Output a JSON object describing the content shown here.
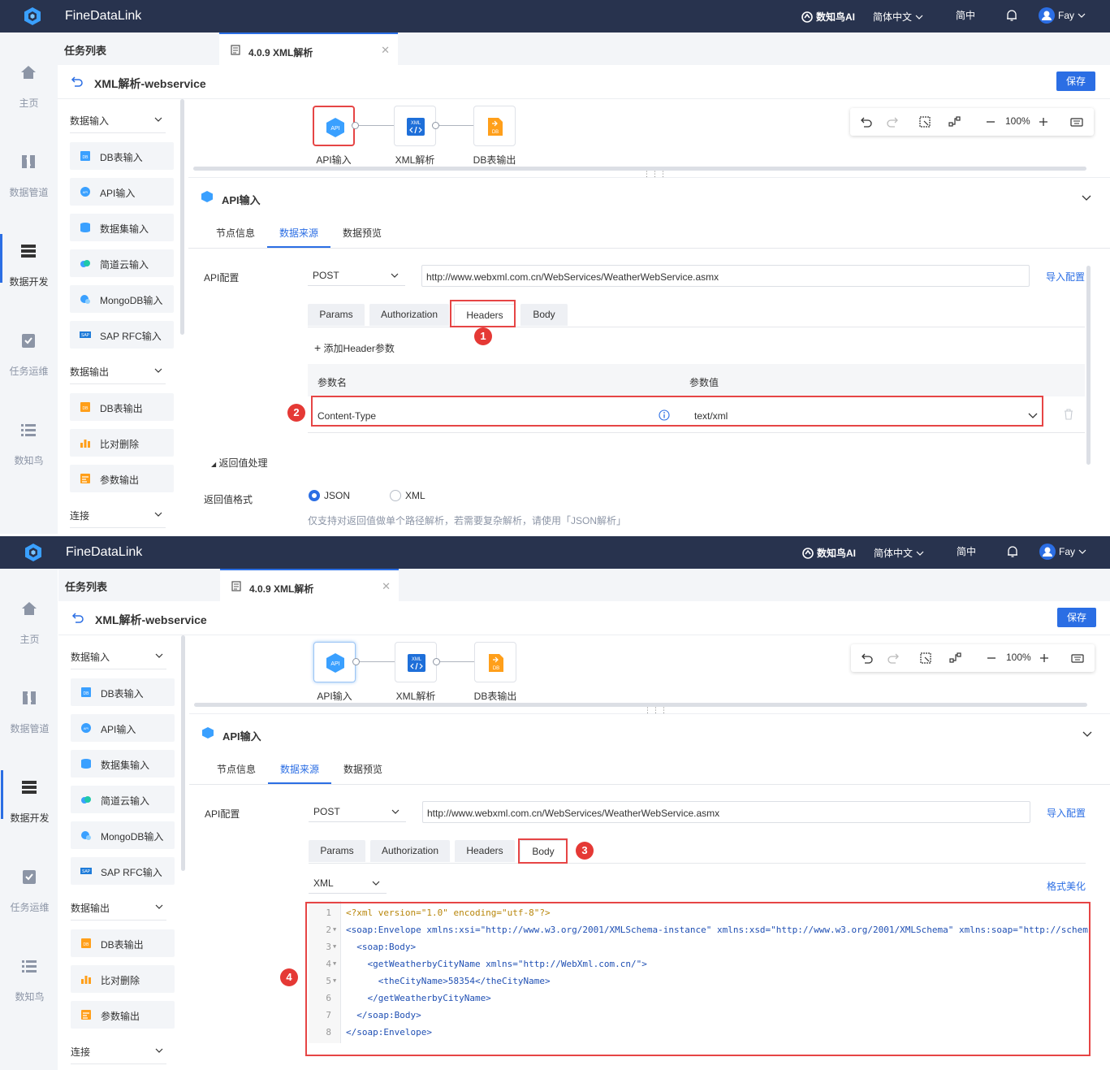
{
  "app": {
    "brand": "FineDataLink",
    "ai_label": "数知鸟AI",
    "language": "简体中文",
    "lang_short": "简中",
    "user": "Fay"
  },
  "nav": [
    {
      "label": "主页",
      "icon": "home-icon"
    },
    {
      "label": "数据管道",
      "icon": "pipeline-icon"
    },
    {
      "label": "数据开发",
      "icon": "dev-icon"
    },
    {
      "label": "任务运维",
      "icon": "ops-icon"
    },
    {
      "label": "数知鸟",
      "icon": "list-icon"
    }
  ],
  "tabs": {
    "list_label": "任务列表",
    "active_tab": "4.0.9 XML解析"
  },
  "task": {
    "title": "XML解析-webservice",
    "save_label": "保存"
  },
  "panel": {
    "input_category": "数据输入",
    "input_items": [
      "DB表输入",
      "API输入",
      "数据集输入",
      "简道云输入",
      "MongoDB输入",
      "SAP RFC输入"
    ],
    "output_category": "数据输出",
    "output_items": [
      "DB表输出",
      "比对删除",
      "参数输出"
    ],
    "connect_category": "连接"
  },
  "flow": {
    "nodes": [
      "API输入",
      "XML解析",
      "DB表输出"
    ],
    "zoom": "100%",
    "node_icon_api": "API",
    "node_icon_xml": "XML",
    "node_icon_db": "DB"
  },
  "config": {
    "title": "API输入",
    "subtabs": [
      "节点信息",
      "数据来源",
      "数据预览"
    ],
    "api_label": "API配置",
    "method": "POST",
    "url": "http://www.webxml.com.cn/WebServices/WeatherWebService.asmx",
    "import_label": "导入配置",
    "param_tabs": [
      "Params",
      "Authorization",
      "Headers",
      "Body"
    ]
  },
  "shotA": {
    "add_header": "添加Header参数",
    "col_name": "参数名",
    "col_value": "参数值",
    "header_name": "Content-Type",
    "header_value": "text/xml",
    "return_section": "返回值处理",
    "return_format_label": "返回值格式",
    "format_json": "JSON",
    "format_xml": "XML",
    "hint": "仅支持对返回值做单个路径解析，若需要复杂解析，请使用「JSON解析」",
    "badge1": "1",
    "badge2": "2"
  },
  "shotB": {
    "body_type": "XML",
    "beautify_label": "格式美化",
    "badge3": "3",
    "badge4": "4",
    "code_lines": [
      "<?xml version=\"1.0\" encoding=\"utf-8\"?>",
      "<soap:Envelope xmlns:xsi=\"http://www.w3.org/2001/XMLSchema-instance\" xmlns:xsd=\"http://www.w3.org/2001/XMLSchema\" xmlns:soap=\"http://schem",
      "  <soap:Body>",
      "    <getWeatherbyCityName xmlns=\"http://WebXml.com.cn/\">",
      "      <theCityName>58354</theCityName>",
      "    </getWeatherbyCityName>",
      "  </soap:Body>",
      "</soap:Envelope>"
    ],
    "line_numbers": [
      "1",
      "2",
      "3",
      "4",
      "5",
      "6",
      "7",
      "8"
    ]
  }
}
